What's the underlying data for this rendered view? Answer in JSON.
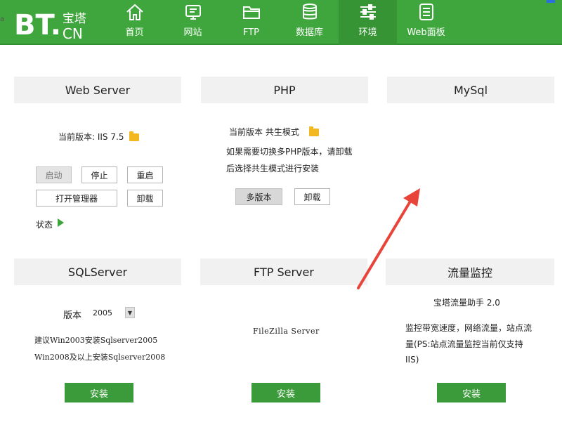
{
  "header": {
    "logo_main": "BT.",
    "logo_cn_top": "宝塔",
    "logo_cn_bottom": "CN",
    "nav": [
      {
        "label": "首页",
        "icon": "home-icon"
      },
      {
        "label": "网站",
        "icon": "monitor-icon"
      },
      {
        "label": "FTP",
        "icon": "folder-icon"
      },
      {
        "label": "数据库",
        "icon": "database-icon"
      },
      {
        "label": "环境",
        "icon": "sliders-icon",
        "active": true
      },
      {
        "label": "Web面板",
        "icon": "panel-list-icon"
      }
    ],
    "edge_mark": "a"
  },
  "webserver": {
    "title": "Web Server",
    "version_text": "当前版本: IIS 7.5",
    "start_label": "启动",
    "stop_label": "停止",
    "restart_label": "重启",
    "open_manager_label": "打开管理器",
    "uninstall_label": "卸载",
    "status_label": "状态"
  },
  "php": {
    "title": "PHP",
    "version_text": "当前版本  共生模式",
    "note_line1": "如果需要切换多PHP版本，请卸载",
    "note_line2": "后选择共生模式进行安装",
    "multi_label": "多版本",
    "uninstall_label": "卸载"
  },
  "mysql": {
    "title": "MySql"
  },
  "sqlserver": {
    "title": "SQLServer",
    "version_label": "版本",
    "version_value": "2005",
    "note_line1": "建议Win2003安装Sqlserver2005",
    "note_line2": "Win2008及以上安装Sqlserver2008",
    "install_label": "安装"
  },
  "ftpserver": {
    "title": "FTP Server",
    "product": "FileZilla Server",
    "install_label": "安装"
  },
  "traffic": {
    "title": "流量监控",
    "subtitle": "宝塔流量助手 2.0",
    "note_line1": "监控带宽速度，网络流量，站点流",
    "note_line2": "量(PS:站点流量监控当前仅支持",
    "note_line3": "IIS)",
    "install_label": "安装"
  },
  "colors": {
    "brand_green": "#3fa63d",
    "active_nav": "#369434",
    "install_button": "#3b9b3a",
    "annotation_arrow": "#e8443a",
    "folder": "#f3b71f"
  }
}
